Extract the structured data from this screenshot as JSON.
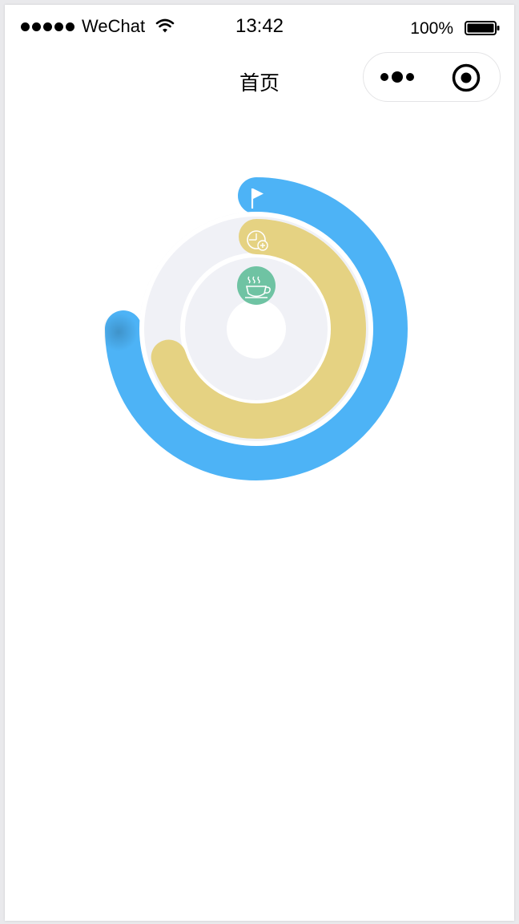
{
  "status_bar": {
    "carrier": "WeChat",
    "time": "13:42",
    "battery": "100%"
  },
  "nav": {
    "title": "首页"
  },
  "ring": {
    "outer_progress": 0.75,
    "inner_progress": 0.7,
    "colors": {
      "outer": "#4db3f6",
      "inner": "#e5d282",
      "track": "#f0f1f6",
      "coffee": "#6fc3a3"
    },
    "icons": [
      "flag-icon",
      "clock-add-icon",
      "coffee-cup-icon"
    ]
  }
}
